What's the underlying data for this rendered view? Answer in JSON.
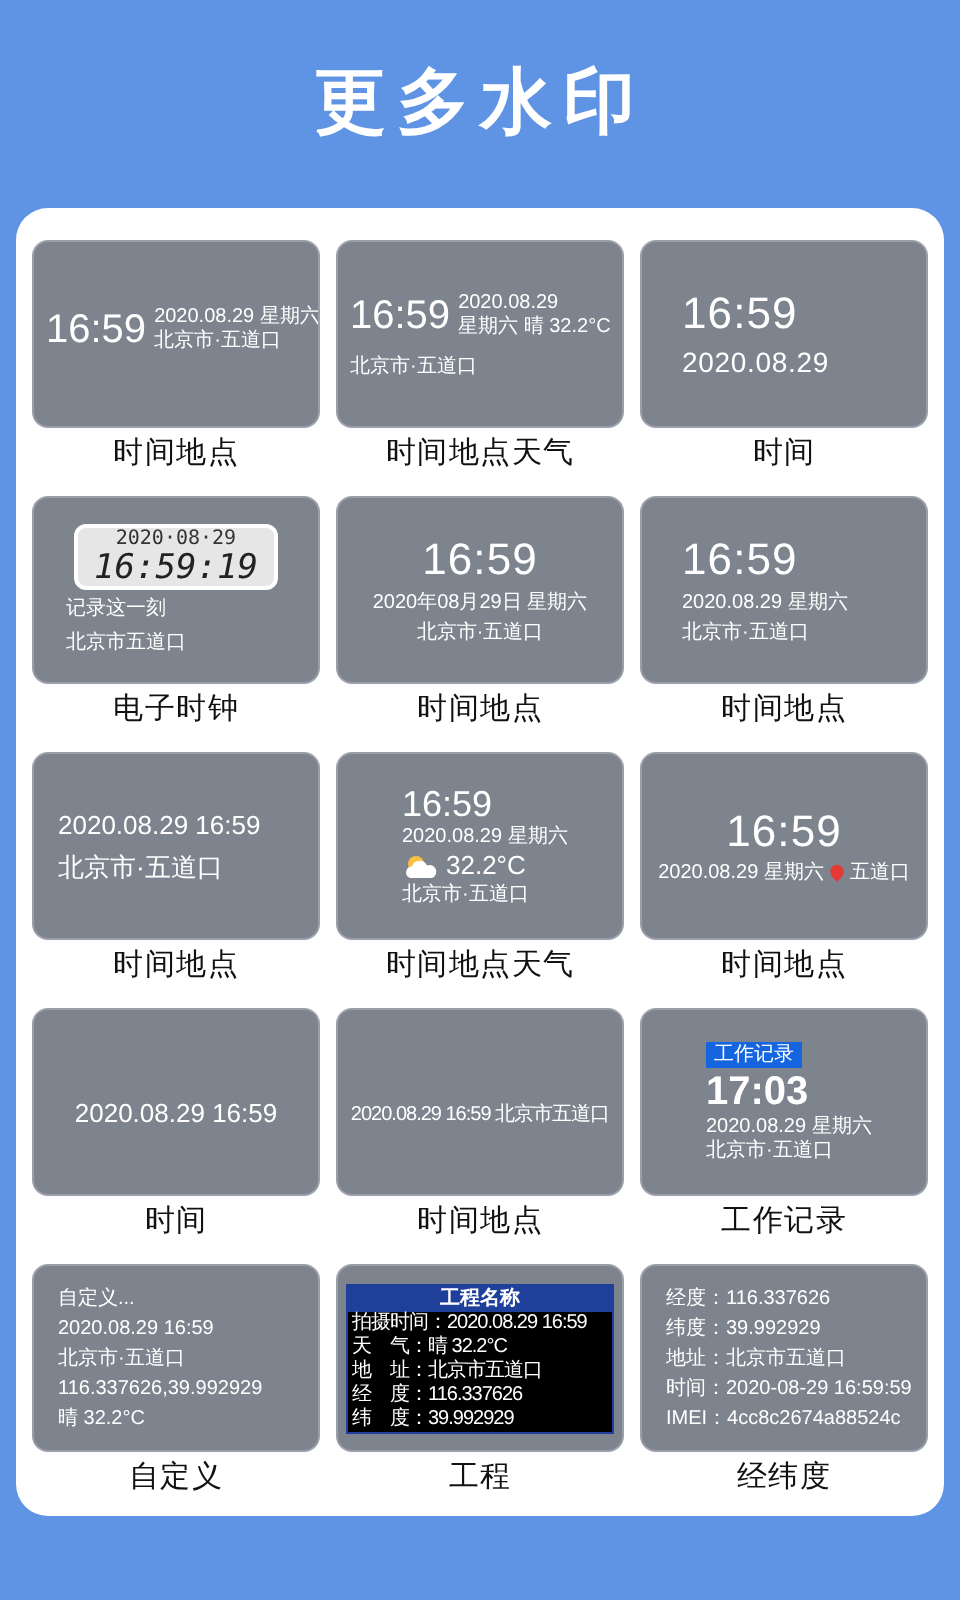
{
  "title": "更多水印",
  "templates": [
    {
      "name": "时间地点",
      "kind": "inline",
      "time": "16:59",
      "side": [
        "2020.08.29 星期六",
        "北京市·五道口"
      ]
    },
    {
      "name": "时间地点天气",
      "kind": "inline",
      "time": "16:59",
      "side": [
        "2020.08.29",
        "星期六 晴 32.2°C"
      ],
      "below": [
        "北京市·五道口"
      ]
    },
    {
      "name": "时间",
      "kind": "clock-date",
      "time": "16:59",
      "date": "2020.08.29"
    },
    {
      "name": "电子时钟",
      "kind": "lcd",
      "date": "2020·08·29",
      "time": "16:59:19",
      "lines": [
        "记录这一刻",
        "北京市五道口"
      ]
    },
    {
      "name": "时间地点",
      "kind": "clock-center",
      "time": "16:59",
      "lines": [
        "2020年08月29日 星期六",
        "北京市·五道口"
      ]
    },
    {
      "name": "时间地点",
      "kind": "clock-left",
      "time": "16:59",
      "lines": [
        "2020.08.29 星期六",
        "北京市·五道口"
      ]
    },
    {
      "name": "时间地点",
      "kind": "large-lines",
      "lines": [
        "2020.08.29 16:59",
        "北京市·五道口"
      ]
    },
    {
      "name": "时间地点天气",
      "kind": "weather",
      "time": "16:59",
      "date": "2020.08.29 星期六",
      "temp": "32.2°C",
      "place": "北京市·五道口"
    },
    {
      "name": "时间地点",
      "kind": "pin",
      "time": "16:59",
      "date": "2020.08.29 星期六",
      "place": "五道口"
    },
    {
      "name": "时间",
      "kind": "single-line",
      "text": "2020.08.29 16:59"
    },
    {
      "name": "时间地点",
      "kind": "bottom-line",
      "text": "2020.08.29 16:59 北京市五道口"
    },
    {
      "name": "工作记录",
      "kind": "badge",
      "badge": "工作记录",
      "time": "17:03",
      "lines": [
        "2020.08.29 星期六",
        "北京市·五道口"
      ]
    },
    {
      "name": "自定义",
      "kind": "small-lines",
      "lines": [
        "自定义...",
        "2020.08.29 16:59",
        "北京市·五道口",
        "116.337626,39.992929",
        "晴 32.2°C"
      ]
    },
    {
      "name": "工程",
      "kind": "table",
      "header": "工程名称",
      "rows": [
        {
          "label": "拍摄时间：",
          "value": "2020.08.29 16:59"
        },
        {
          "label": "天　气：",
          "value": "晴 32.2°C"
        },
        {
          "label": "地　址：",
          "value": "北京市五道口"
        },
        {
          "label": "经　度：",
          "value": "116.337626"
        },
        {
          "label": "纬　度：",
          "value": "39.992929"
        }
      ]
    },
    {
      "name": "经纬度",
      "kind": "small-lines",
      "lines": [
        "经度：116.337626",
        "纬度：39.992929",
        "地址：北京市五道口",
        "时间：2020-08-29 16:59:59",
        "IMEI：4cc8c2674a88524c"
      ]
    }
  ]
}
